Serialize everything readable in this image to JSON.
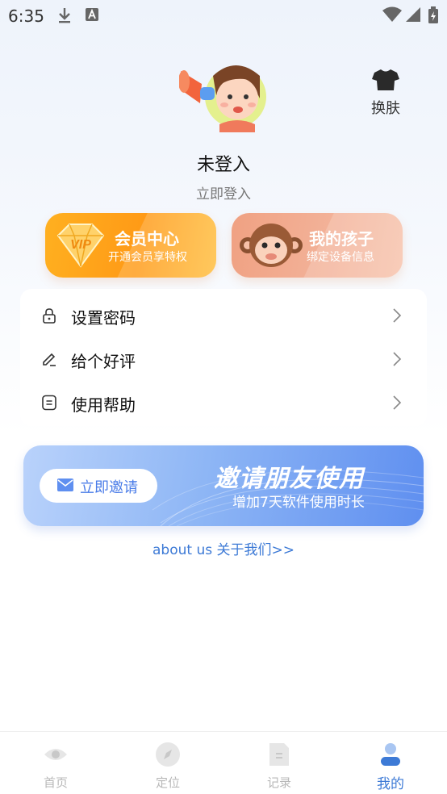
{
  "status_bar": {
    "time": "6:35"
  },
  "header": {
    "skin_label": "换肤"
  },
  "profile": {
    "title": "未登入",
    "login_link": "立即登入"
  },
  "cards": {
    "vip": {
      "title": "会员中心",
      "subtitle": "开通会员享特权"
    },
    "kid": {
      "title": "我的孩子",
      "subtitle": "绑定设备信息"
    }
  },
  "menu": {
    "items": [
      {
        "label": "设置密码",
        "icon": "lock-icon"
      },
      {
        "label": "给个好评",
        "icon": "pencil-icon"
      },
      {
        "label": "使用帮助",
        "icon": "document-icon"
      }
    ]
  },
  "invite": {
    "button_label": "立即邀请",
    "title": "邀请朋友使用",
    "subtitle": "增加7天软件使用时长"
  },
  "about_link": "about us 关于我们>>",
  "tabs": [
    {
      "label": "首页",
      "icon": "eye-icon",
      "active": false
    },
    {
      "label": "定位",
      "icon": "compass-icon",
      "active": false
    },
    {
      "label": "记录",
      "icon": "document-icon",
      "active": false
    },
    {
      "label": "我的",
      "icon": "user-icon",
      "active": true
    }
  ],
  "colors": {
    "accent": "#3d7ad6",
    "vip": "#ff9a16",
    "kid": "#f0a182",
    "invite": "#5f8ff0"
  }
}
